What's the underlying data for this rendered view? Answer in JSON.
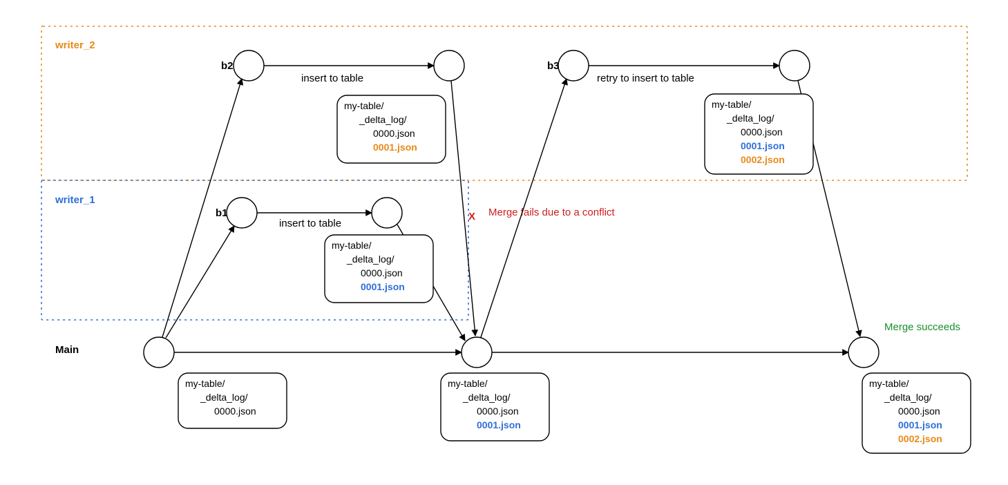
{
  "labels": {
    "main": "Main",
    "writer1": "writer_1",
    "writer2": "writer_2",
    "b1": "b1",
    "b2": "b2",
    "b3": "b3",
    "w2_action1": "insert to table",
    "w1_action1": "insert to table",
    "w2_retry": "retry to insert to table",
    "merge_fail": "Merge fails due to a conflict",
    "merge_ok": "Merge succeeds",
    "x_mark": "X"
  },
  "filebox": {
    "root": "my-table/",
    "log": "_delta_log/",
    "f0": "0000.json",
    "f1": "0001.json",
    "f2": "0002.json"
  }
}
